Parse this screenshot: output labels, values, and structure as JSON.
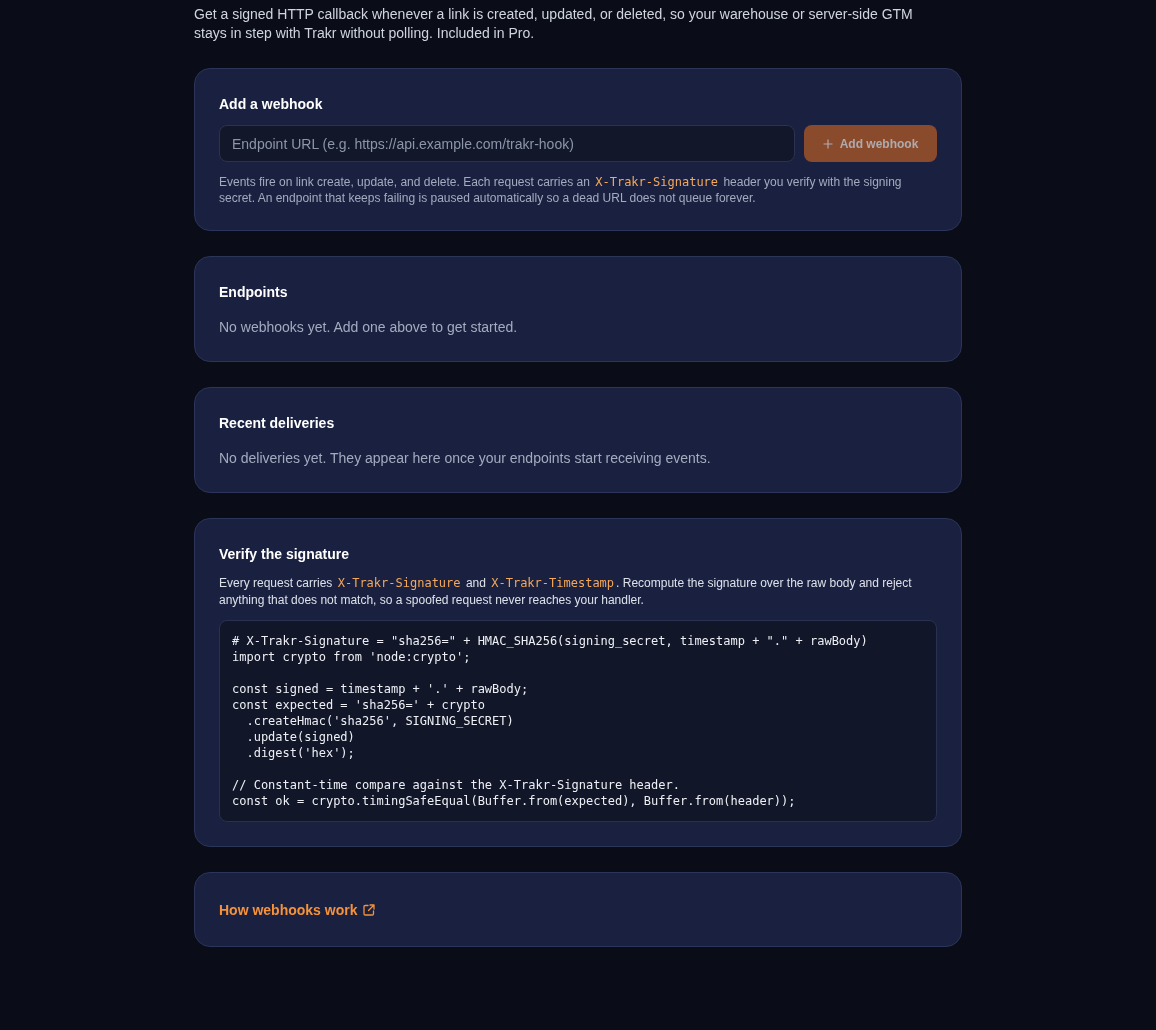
{
  "intro": "Get a signed HTTP callback whenever a link is created, updated, or deleted, so your warehouse or server-side GTM stays in step with Trakr without polling. Included in Pro.",
  "add_webhook": {
    "title": "Add a webhook",
    "url_field": {
      "placeholder": "Endpoint URL (e.g. https://api.example.com/trakr-hook)"
    },
    "button": {
      "label": "Add webhook",
      "disabled": true
    },
    "hint": [
      {
        "kind": "text",
        "text": "Events fire on link create, update, and delete. Each request carries an "
      },
      {
        "kind": "code",
        "text": "X-Trakr-Signature"
      },
      {
        "kind": "text",
        "text": " header you verify with the signing secret. An endpoint that keeps failing is paused automatically so a dead URL does not queue forever."
      }
    ]
  },
  "endpoints": {
    "title": "Endpoints",
    "empty_text": "No webhooks yet. Add one above to get started."
  },
  "recent_deliveries": {
    "title": "Recent deliveries",
    "empty_text": "No deliveries yet. They appear here once your endpoints start receiving events."
  },
  "verify": {
    "title": "Verify the signature",
    "description": [
      {
        "kind": "text",
        "text": "Every request carries "
      },
      {
        "kind": "code",
        "text": "X-Trakr-Signature"
      },
      {
        "kind": "text",
        "text": " and "
      },
      {
        "kind": "code",
        "text": "X-Trakr-Timestamp"
      },
      {
        "kind": "text",
        "text": ". Recompute the signature over the raw body and reject anything that does not match, so a spoofed request never reaches your handler."
      }
    ],
    "code": "# X-Trakr-Signature = \"sha256=\" + HMAC_SHA256(signing_secret, timestamp + \".\" + rawBody)\nimport crypto from 'node:crypto';\n\nconst signed = timestamp + '.' + rawBody;\nconst expected = 'sha256=' + crypto\n  .createHmac('sha256', SIGNING_SECRET)\n  .update(signed)\n  .digest('hex');\n\n// Constant-time compare against the X-Trakr-Signature header.\nconst ok = crypto.timingSafeEqual(Buffer.from(expected), Buffer.from(header));"
  },
  "docs_link": {
    "label": "How webhooks work"
  }
}
